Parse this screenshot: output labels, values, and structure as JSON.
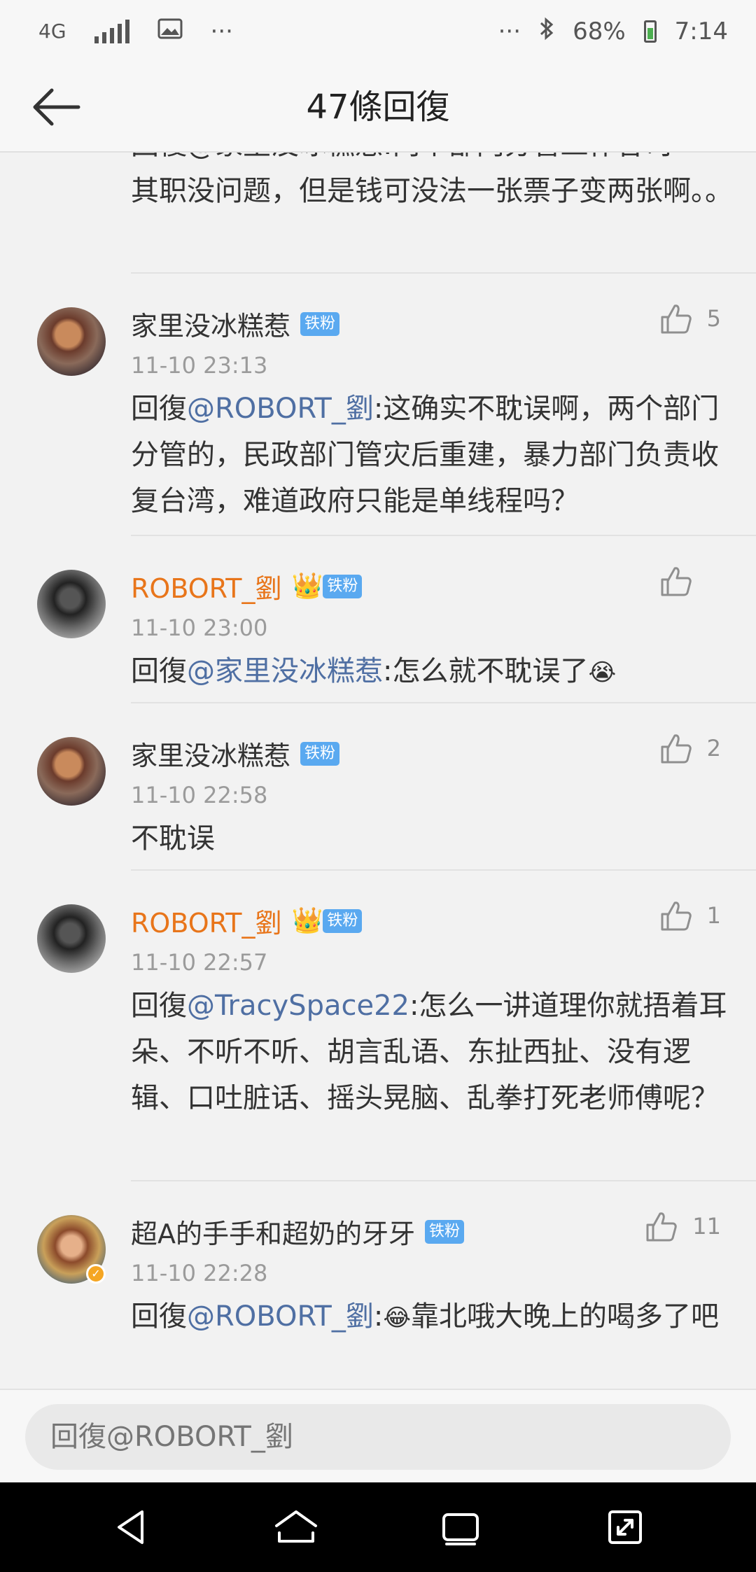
{
  "status_bar": {
    "network": "4G",
    "more_left": "···",
    "more_right": "···",
    "battery": "68%",
    "time": "7:14"
  },
  "header": {
    "title": "47條回復"
  },
  "partial_comment": {
    "line_clipped": "回復@家里没冰糕惹:两个部门分管工作各司",
    "text": "其职没问题，但是钱可没法一张票子变两张啊。。"
  },
  "comments": [
    {
      "name": "家里没冰糕惹",
      "badge": "铁粉",
      "time": "11-10 23:13",
      "likes": "5",
      "prefix": "回復",
      "mention": "@ROBORT_劉",
      "text": ":这确实不耽误啊，两个部门分管的，民政部门管灾后重建，暴力部门负责收复台湾，难道政府只能是单线程吗？"
    },
    {
      "name": "ROBORT_劉",
      "badge": "铁粉",
      "time": "11-10 23:00",
      "likes": "",
      "prefix": "回復",
      "mention": "@家里没冰糕惹",
      "text": ":怎么就不耽误了",
      "emoji": "😭"
    },
    {
      "name": "家里没冰糕惹",
      "badge": "铁粉",
      "time": "11-10 22:58",
      "likes": "2",
      "text": "不耽误"
    },
    {
      "name": "ROBORT_劉",
      "badge": "铁粉",
      "time": "11-10 22:57",
      "likes": "1",
      "prefix": "回復",
      "mention": "@TracySpace22",
      "text": ":怎么一讲道理你就捂着耳朵、不听不听、胡言乱语、东扯西扯、没有逻辑、口吐脏话、摇头晃脑、乱拳打死老师傅呢？"
    },
    {
      "name": "超A的手手和超奶的牙牙",
      "badge": "铁粉",
      "time": "11-10 22:28",
      "likes": "11",
      "prefix": "回復",
      "mention": "@ROBORT_劉",
      "emoji": "😂",
      "text": "靠北哦大晚上的喝多了吧"
    }
  ],
  "reply_input": {
    "placeholder": "回復@ROBORT_劉"
  },
  "icons": {
    "back": "back-arrow-icon",
    "like": "thumbs-up-icon",
    "nav_back": "triangle-back-icon",
    "nav_home": "home-icon",
    "nav_recent": "recent-apps-icon",
    "nav_expand": "expand-icon"
  },
  "colors": {
    "mention": "#4f6fa3",
    "vip_name": "#e8751a",
    "badge": "#5aa9f0"
  }
}
